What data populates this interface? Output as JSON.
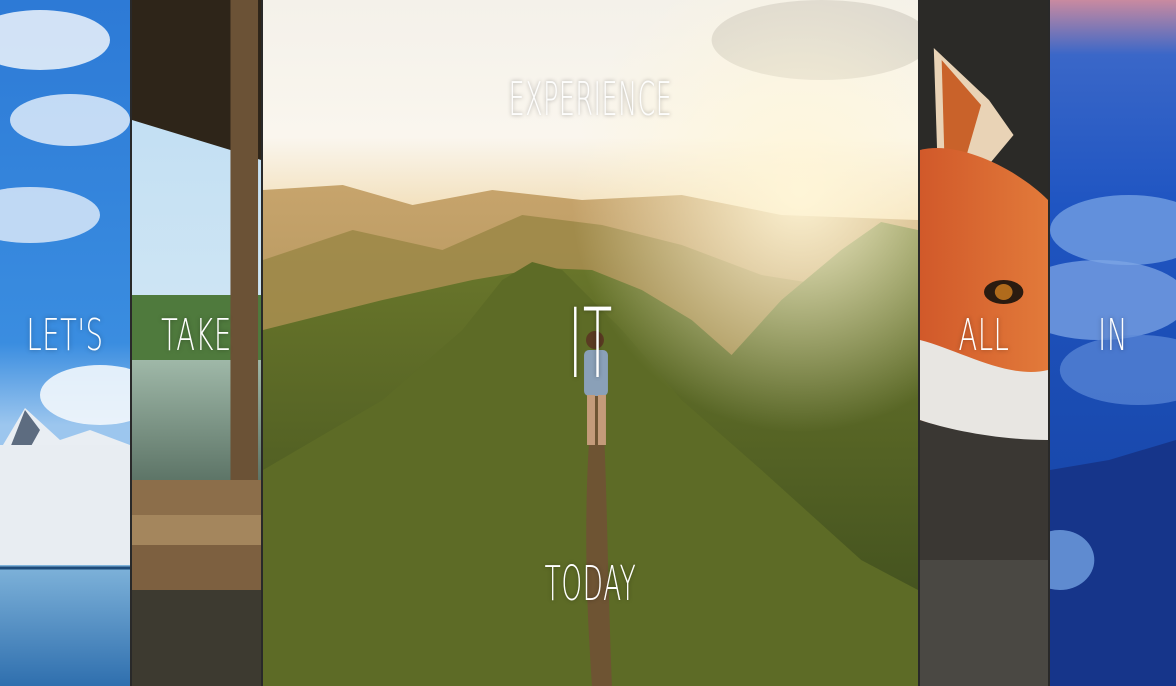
{
  "panels": [
    {
      "id": "p1",
      "word": "Let's",
      "scene": "snowy mountain lake"
    },
    {
      "id": "p2",
      "word": "Take",
      "scene": "wooden dock by misty lake"
    },
    {
      "id": "p3",
      "word_top": "Experience",
      "word_main": "It",
      "word_bottom": "Today",
      "scene": "hiker on mountain ridge at sunset"
    },
    {
      "id": "p4",
      "word": "All",
      "scene": "red fox close-up"
    },
    {
      "id": "p5",
      "word": "In",
      "scene": "blue sky above clouds and sea"
    }
  ]
}
